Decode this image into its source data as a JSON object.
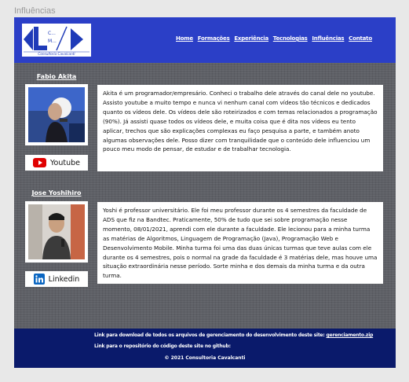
{
  "page_label": "Influências",
  "logo": {
    "letters": "C... M...",
    "caption": "Consultoria Cavalcanti"
  },
  "nav": [
    "Home",
    "Formações",
    "Experiência",
    "Tecnologias",
    "Influências",
    "Contato"
  ],
  "people": [
    {
      "name": "Fabio Akita",
      "social": "Youtube",
      "social_icon": "youtube-icon",
      "bio": "Akita é um programador/empresário. Conheci o trabalho dele através do canal dele no youtube. Assisto youtube a muito tempo e nunca vi nenhum canal com vídeos tão técnicos e dedicados quanto os vídeos dele. Os vídeos dele são roteirizados e com temas relacionados a programação (90%). Já assisti quase todos os vídeos dele, e muita coisa que é dita nos vídeos eu tento aplicar, trechos que são explicações complexas eu faço pesquisa a parte, e também anoto algumas observações dele. Posso dizer com tranquilidade que o conteúdo dele influenciou um pouco meu modo de pensar, de estudar e de trabalhar tecnologia."
    },
    {
      "name": "Jose Yoshihiro",
      "social": "Linkedin",
      "social_icon": "linkedin-icon",
      "bio": "Yoshi é professor universitário. Ele foi meu professor durante os 4 semestres da faculdade de ADS que fiz na Bandtec. Praticamente, 50% de tudo que sei sobre programação nesse momento, 08/01/2021, aprendi com ele durante a faculdade. Ele lecionou para a minha turma as matérias de Algoritmos, Linguagem de Programação (Java), Programação Web e Desenvolvimento Mobile. Minha turma foi uma das duas únicas turmas que teve aulas com ele durante os 4 semestres, pois o normal na grade da faculdade é 3 matérias dele, mas houve uma situação extraordinária nesse período. Sorte minha e dos demais da minha turma e da outra turma."
    }
  ],
  "footer": {
    "download_text": "Link para download de todos os arquivos de gerenciamento do desenvolvimento deste site:",
    "download_link": "gerenciamento.zip",
    "repo_text": "Link para o repositório do código deste site no github:",
    "copyright": "© 2021 Consultoria Cavalcanti"
  },
  "colors": {
    "header": "#2b3fc7",
    "footer": "#0a1a6b",
    "youtube": "#e00000",
    "linkedin": "#0a66c2"
  }
}
